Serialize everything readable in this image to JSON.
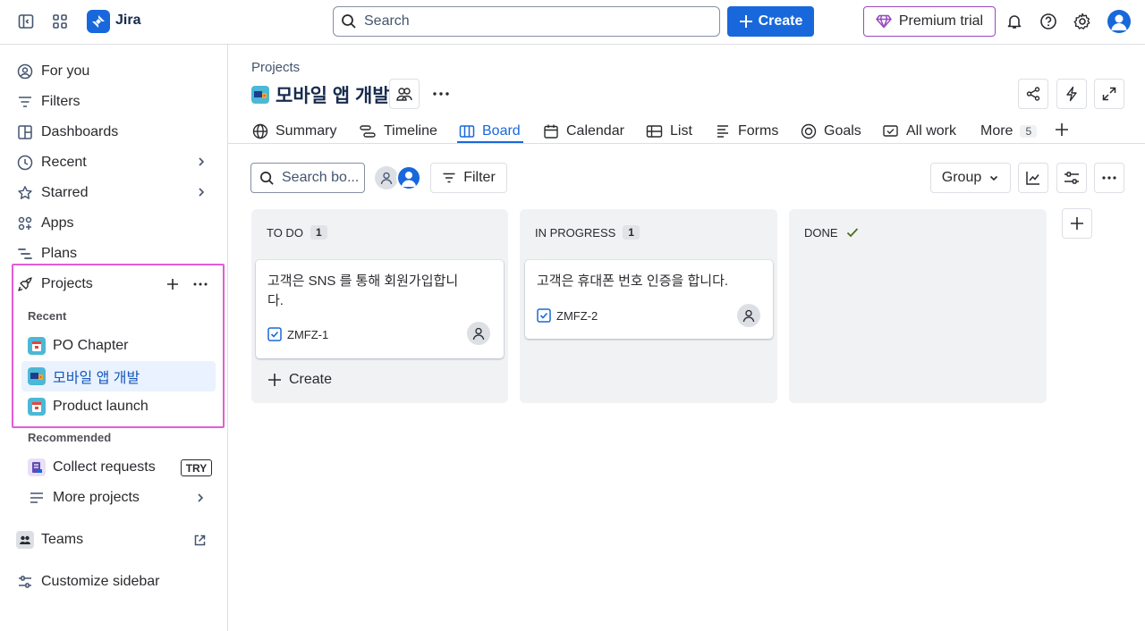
{
  "topbar": {
    "app_name": "Jira",
    "search_placeholder": "Search",
    "create_label": "Create",
    "premium_label": "Premium trial"
  },
  "sidebar": {
    "items": [
      {
        "label": "For you",
        "icon": "person-circle-icon"
      },
      {
        "label": "Filters",
        "icon": "filter-icon"
      },
      {
        "label": "Dashboards",
        "icon": "dashboard-icon"
      },
      {
        "label": "Recent",
        "icon": "clock-icon"
      },
      {
        "label": "Starred",
        "icon": "star-icon"
      },
      {
        "label": "Apps",
        "icon": "apps-icon"
      },
      {
        "label": "Plans",
        "icon": "plans-icon"
      }
    ],
    "projects": {
      "label": "Projects",
      "recent_label": "Recent",
      "recent": [
        {
          "label": "PO Chapter"
        },
        {
          "label": "모바일 앱 개발"
        },
        {
          "label": "Product launch"
        }
      ],
      "recommended_label": "Recommended",
      "recommended": [
        {
          "label": "Collect requests",
          "badge": "TRY"
        },
        {
          "label": "More projects"
        }
      ]
    },
    "teams_label": "Teams",
    "customize_label": "Customize sidebar"
  },
  "header": {
    "breadcrumb": "Projects",
    "title": "모바일 앱 개발"
  },
  "tabs": [
    {
      "label": "Summary"
    },
    {
      "label": "Timeline"
    },
    {
      "label": "Board"
    },
    {
      "label": "Calendar"
    },
    {
      "label": "List"
    },
    {
      "label": "Forms"
    },
    {
      "label": "Goals"
    },
    {
      "label": "All work"
    },
    {
      "label": "More",
      "count": "5"
    }
  ],
  "toolbar": {
    "search_placeholder": "Search bo...",
    "filter_label": "Filter",
    "group_label": "Group"
  },
  "columns": [
    {
      "title": "TO DO",
      "count": "1",
      "cards": [
        {
          "title": "고객은 SNS 를 통해 회원가입합니다.",
          "key": "ZMFZ-1"
        }
      ],
      "create_label": "Create"
    },
    {
      "title": "IN PROGRESS",
      "count": "1",
      "cards": [
        {
          "title": "고객은 휴대폰 번호 인증을 합니다.",
          "key": "ZMFZ-2"
        }
      ]
    },
    {
      "title": "DONE",
      "count": "",
      "cards": []
    }
  ],
  "colors": {
    "accent": "#1868db",
    "highlight": "#e35cd6",
    "done_check": "#4c6b1f"
  }
}
